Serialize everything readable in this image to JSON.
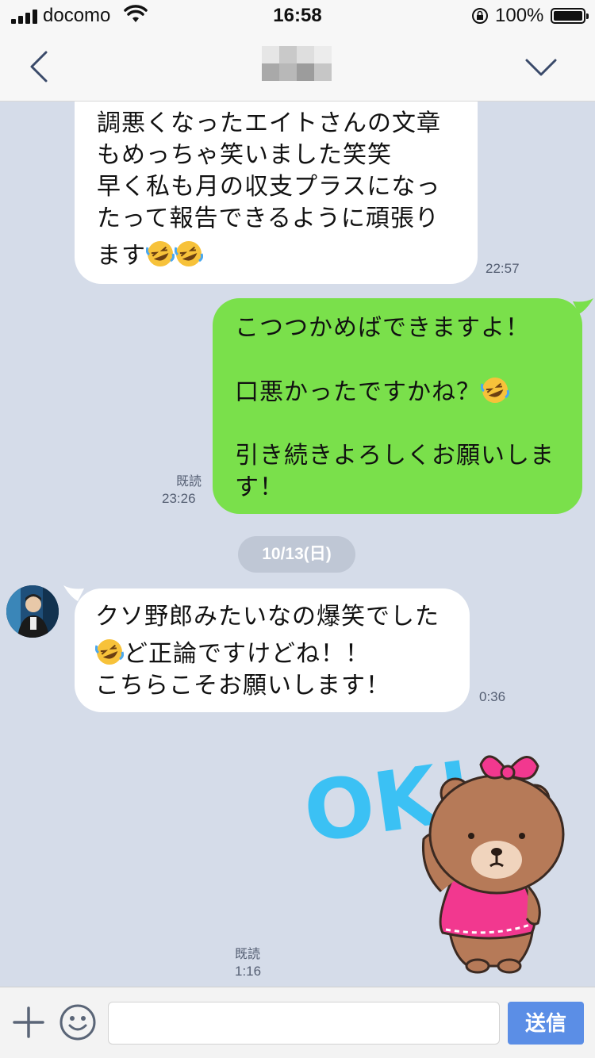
{
  "status_bar": {
    "carrier": "docomo",
    "time": "16:58",
    "battery": "100%"
  },
  "nav": {
    "back_icon": "chevron-left-icon",
    "menu_icon": "chevron-down-icon"
  },
  "messages": [
    {
      "lines": [
        "調悪くなったエイトさんの文章",
        "もめっちゃ笑いました笑笑",
        "早く私も月の収支プラスになっ",
        "たって報告できるように頑張り",
        "ます"
      ],
      "time": "22:57"
    },
    {
      "lines": [
        "こつつかめばできますよ！",
        "",
        "口悪かったですかね？",
        "",
        "引き続きよろしくお願いしま",
        "す！"
      ],
      "read": "既読",
      "time": "23:26"
    },
    {
      "lines": [
        "クソ野郎みたいなの爆笑でした",
        "ど正論ですけどね！！",
        "こちらこそお願いします！"
      ],
      "time": "0:36"
    }
  ],
  "date_divider": "10/13(日)",
  "sticker": {
    "text": "OK!",
    "read": "既読",
    "time": "1:16"
  },
  "input": {
    "placeholder": "",
    "send_label": "送信"
  },
  "colors": {
    "background": "#d5dce9",
    "outgoing": "#7ae04b",
    "incoming": "#ffffff",
    "send": "#5b8ee6"
  }
}
